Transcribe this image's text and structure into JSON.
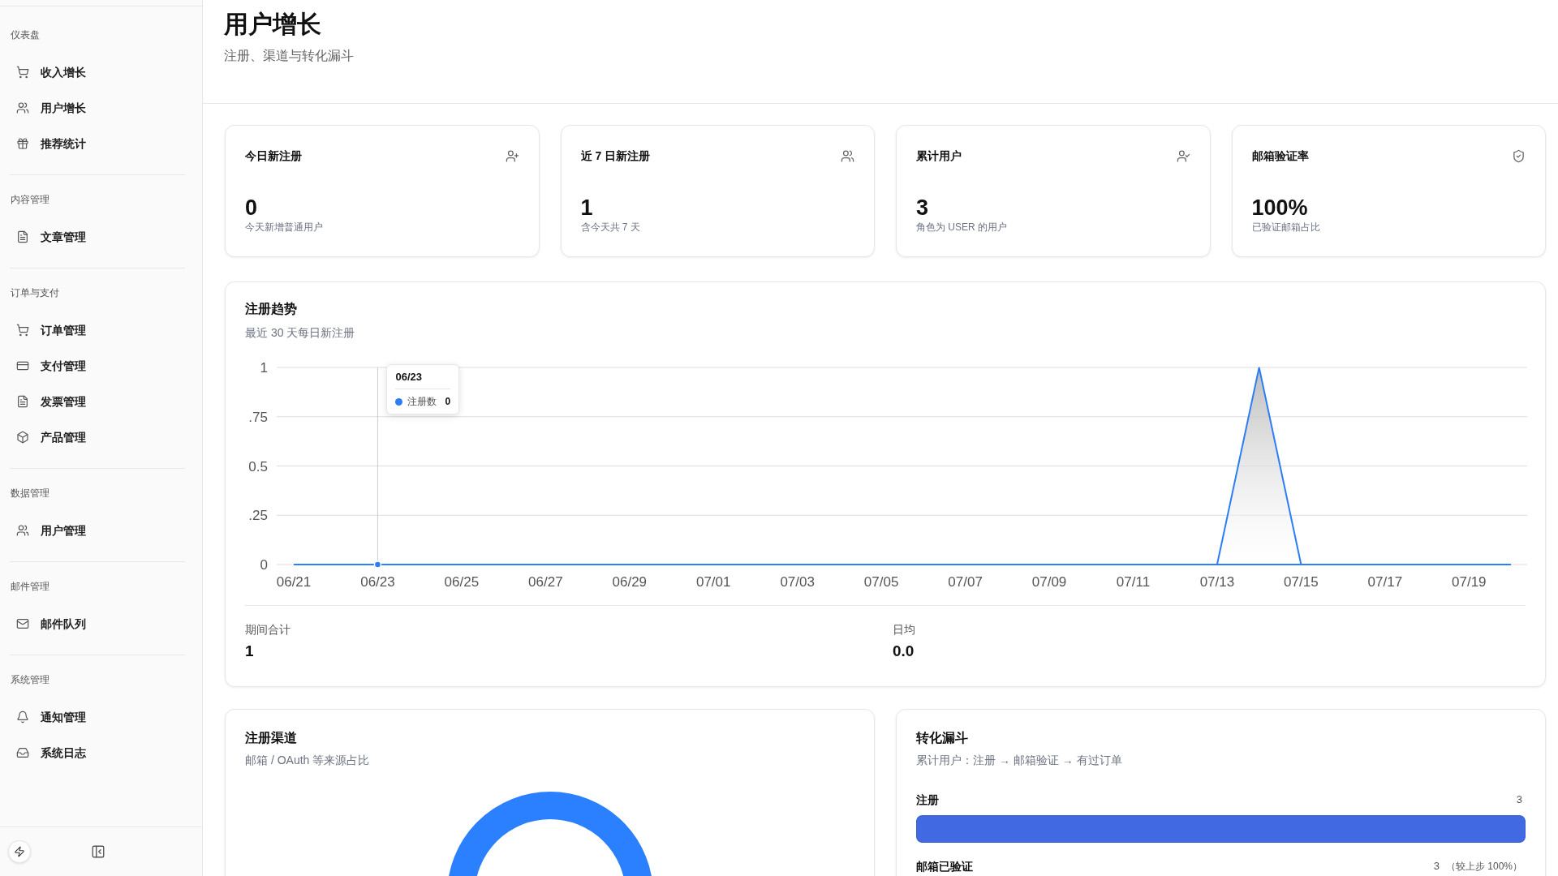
{
  "sidebar": {
    "groups": [
      {
        "label": "仪表盘",
        "items": [
          {
            "label": "收入增长",
            "selected": false
          },
          {
            "label": "用户增长",
            "selected": false
          },
          {
            "label": "推荐统计",
            "selected": false
          }
        ]
      },
      {
        "label": "内容管理",
        "items": [
          {
            "label": "文章管理",
            "selected": false
          }
        ]
      },
      {
        "label": "订单与支付",
        "items": [
          {
            "label": "订单管理",
            "selected": false
          },
          {
            "label": "支付管理",
            "selected": false
          },
          {
            "label": "发票管理",
            "selected": false
          },
          {
            "label": "产品管理",
            "selected": false
          }
        ]
      },
      {
        "label": "数据管理",
        "items": [
          {
            "label": "用户管理",
            "selected": false
          }
        ]
      },
      {
        "label": "邮件管理",
        "items": [
          {
            "label": "邮件队列",
            "selected": false
          }
        ]
      },
      {
        "label": "系统管理",
        "items": [
          {
            "label": "通知管理",
            "selected": false
          },
          {
            "label": "系统日志",
            "selected": false
          }
        ]
      }
    ]
  },
  "header": {
    "title": "用户增长",
    "subtitle": "注册、渠道与转化漏斗"
  },
  "stat_cards": [
    {
      "title": "今日新注册",
      "value": "0",
      "caption": "今天新增普通用户"
    },
    {
      "title": "近 7 日新注册",
      "value": "1",
      "caption": "含今天共 7 天"
    },
    {
      "title": "累计用户",
      "value": "3",
      "caption": "角色为 USER 的用户"
    },
    {
      "title": "邮箱验证率",
      "value": "100%",
      "caption": "已验证邮箱占比"
    }
  ],
  "trend": {
    "title": "注册趋势",
    "subtitle": "最近 30 天每日新注册",
    "chart_data": {
      "type": "area",
      "categories": [
        "06/21",
        null,
        "06/23",
        null,
        "06/25",
        null,
        "06/27",
        null,
        "06/29",
        null,
        "07/01",
        null,
        "07/03",
        null,
        "07/05",
        null,
        "07/07",
        null,
        "07/09",
        null,
        "07/11",
        null,
        "07/13",
        null,
        "07/15",
        null,
        "07/17",
        null,
        "07/19",
        null
      ],
      "series": [
        {
          "color": "#2b7ef6",
          "values": [
            0,
            0,
            0,
            0,
            0,
            0,
            0,
            0,
            0,
            0,
            0,
            0,
            0,
            0,
            0,
            0,
            0,
            0,
            0,
            0,
            0,
            0,
            0,
            1,
            0,
            0,
            0,
            0,
            0,
            0
          ]
        }
      ],
      "ylim": [
        0,
        1
      ],
      "yticks": [
        0,
        {
          "value": 0.25,
          "label": ".25"
        },
        0.5,
        {
          "value": 0.75,
          "label": ".75"
        },
        1
      ],
      "grid": true
    },
    "tooltip": {
      "title": "06/23",
      "items": [
        {
          "name": "注册数",
          "value": "0"
        }
      ]
    },
    "summary": [
      {
        "label": "期间合计",
        "value": "1"
      },
      {
        "label": "日均",
        "value": "0.0"
      }
    ]
  },
  "channels": {
    "title": "注册渠道",
    "subtitle": "邮箱 / OAuth 等来源占比"
  },
  "funnel": {
    "title": "转化漏斗",
    "subtitle": "累计用户：注册 → 邮箱验证 → 有过订单",
    "steps": [
      {
        "label": "注册",
        "count": "3",
        "level": 1
      },
      {
        "label": "邮箱已验证",
        "count": "3",
        "note": "（较上步 100%）"
      }
    ]
  }
}
